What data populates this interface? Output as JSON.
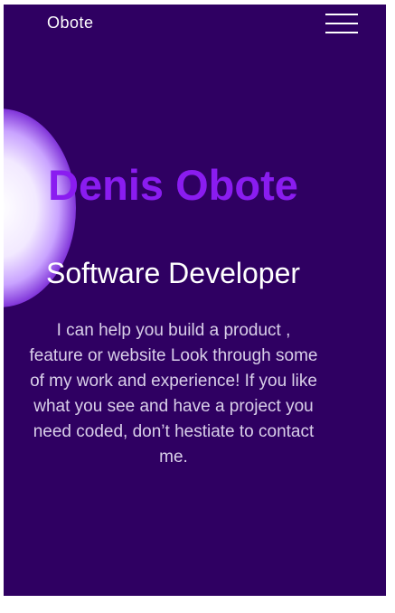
{
  "header": {
    "brand": "Obote",
    "menu_icon": "hamburger-menu-icon"
  },
  "hero": {
    "name": "Denis Obote",
    "role": "Software Developer",
    "description": "I can help you build a product , feature or website Look through some of my work and experience! If you like what you see and have a project you need coded, don’t hestiate to contact me."
  },
  "colors": {
    "background": "#2f0062",
    "accent": "#8a1cf0",
    "text": "#ffffff",
    "muted_text": "#d9cfe9"
  }
}
